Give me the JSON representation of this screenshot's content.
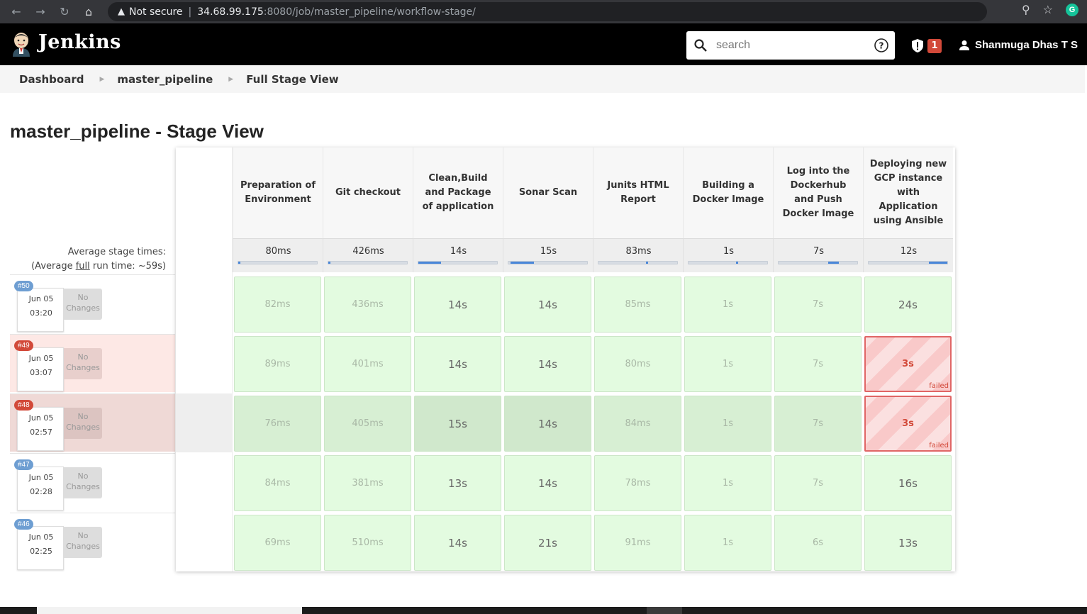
{
  "browser": {
    "security": "Not secure",
    "url_host": "34.68.99.175",
    "url_path": ":8080/job/master_pipeline/workflow-stage/",
    "profile_letter": "G"
  },
  "header": {
    "brand": "Jenkins",
    "search_placeholder": "search",
    "alert_count": "1",
    "user_name": "Shanmuga Dhas T S"
  },
  "breadcrumb": [
    "Dashboard",
    "master_pipeline",
    "Full Stage View"
  ],
  "title": "master_pipeline - Stage View",
  "avg": {
    "line1": "Average stage times:",
    "line2_pre": "(Average ",
    "line2_link": "full",
    "line2_post": " run time: ~59s)"
  },
  "stages": [
    {
      "name": "Preparation of Environment",
      "avg": "80ms",
      "bar": [
        0.0,
        0.0
      ]
    },
    {
      "name": "Git checkout",
      "avg": "426ms",
      "bar": [
        0.0,
        0.02
      ]
    },
    {
      "name": "Clean,Build and Package of application",
      "avg": "14s",
      "bar": [
        0.0,
        0.29
      ]
    },
    {
      "name": "Sonar Scan",
      "avg": "15s",
      "bar": [
        0.03,
        0.32
      ]
    },
    {
      "name": "Junits HTML Report",
      "avg": "83ms",
      "bar": [
        0.6,
        0.61
      ]
    },
    {
      "name": "Building a Docker Image",
      "avg": "1s",
      "bar": [
        0.6,
        0.63
      ]
    },
    {
      "name": "Log into the Dockerhub and Push Docker Image",
      "avg": "7s",
      "bar": [
        0.63,
        0.77
      ]
    },
    {
      "name": "Deploying new GCP instance with Application using Ansible",
      "avg": "12s",
      "bar": [
        0.77,
        1.0
      ]
    }
  ],
  "no_changes": "No Changes",
  "failed_label": "failed",
  "builds": [
    {
      "id": "#50",
      "date": "Jun 05",
      "time": "03:20",
      "status": "success",
      "times": [
        "82ms",
        "436ms",
        "14s",
        "14s",
        "85ms",
        "1s",
        "7s",
        "24s"
      ]
    },
    {
      "id": "#49",
      "date": "Jun 05",
      "time": "03:07",
      "status": "failed",
      "times": [
        "89ms",
        "401ms",
        "14s",
        "14s",
        "80ms",
        "1s",
        "7s",
        "3s"
      ]
    },
    {
      "id": "#48",
      "date": "Jun 05",
      "time": "02:57",
      "status": "failed",
      "times": [
        "76ms",
        "405ms",
        "15s",
        "14s",
        "84ms",
        "1s",
        "7s",
        "3s"
      ]
    },
    {
      "id": "#47",
      "date": "Jun 05",
      "time": "02:28",
      "status": "success",
      "times": [
        "84ms",
        "381ms",
        "13s",
        "14s",
        "78ms",
        "1s",
        "7s",
        "16s"
      ]
    },
    {
      "id": "#46",
      "date": "Jun 05",
      "time": "02:25",
      "status": "success",
      "times": [
        "69ms",
        "510ms",
        "14s",
        "21s",
        "91ms",
        "1s",
        "6s",
        "13s"
      ]
    }
  ],
  "colors": {
    "success_cell": "#e3fbe0",
    "failed_accent": "#d24939",
    "progress": "#4a87d9",
    "header_bg": "#000000"
  }
}
